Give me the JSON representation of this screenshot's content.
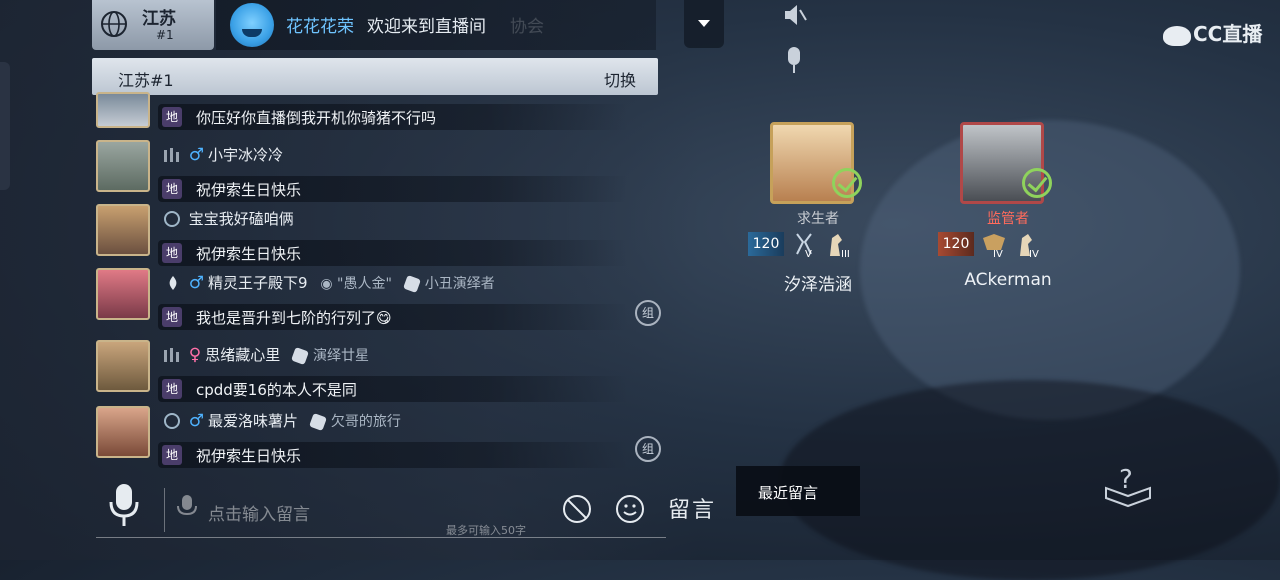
{
  "app": {
    "logo_text": "CC直播"
  },
  "region": {
    "name": "江苏",
    "rank": "#1"
  },
  "welcome": {
    "username": "花花花荣",
    "message": "欢迎来到直播间",
    "ghost_text": "协会"
  },
  "switch_bar": {
    "label": "江苏#1",
    "action": "切换"
  },
  "chat": {
    "badge_text": "地",
    "messages": [
      {
        "text": "你压好你直播倒我开机你骑猪不行吗"
      },
      {
        "username": "小宇冰冷冷",
        "gender": "♂",
        "text": "祝伊索生日快乐"
      },
      {
        "username": "宝宝我好磕咱俩",
        "text": "祝伊索生日快乐"
      },
      {
        "username": "精灵王子殿下9",
        "gender": "♂",
        "title": "\"愚人金\"",
        "tag": "小丑演绎者",
        "text": "我也是晋升到七阶的行列了😋"
      },
      {
        "username": "思绪藏心里",
        "gender": "♀",
        "tag": "演绎廿星",
        "text": "cpdd要16的本人不是同"
      },
      {
        "username": "最爱洛味薯片",
        "gender": "♂",
        "tag": "欠哥的旅行",
        "text": "祝伊索生日快乐"
      }
    ],
    "group_icon_text": "组"
  },
  "input": {
    "placeholder": "点击输入留言",
    "limit_hint": "最多可输入50字",
    "send_label": "留言"
  },
  "recent_popup": {
    "label": "最近留言"
  },
  "players": [
    {
      "role": "求生者",
      "role_color": "#c8ccd2",
      "level": "120",
      "rank1": "V",
      "rank2": "III",
      "name": "汐泽浩涵"
    },
    {
      "role": "监管者",
      "role_color": "#ff6b5c",
      "level": "120",
      "rank1": "IV",
      "rank2": "IV",
      "name": "ACkerman"
    }
  ]
}
